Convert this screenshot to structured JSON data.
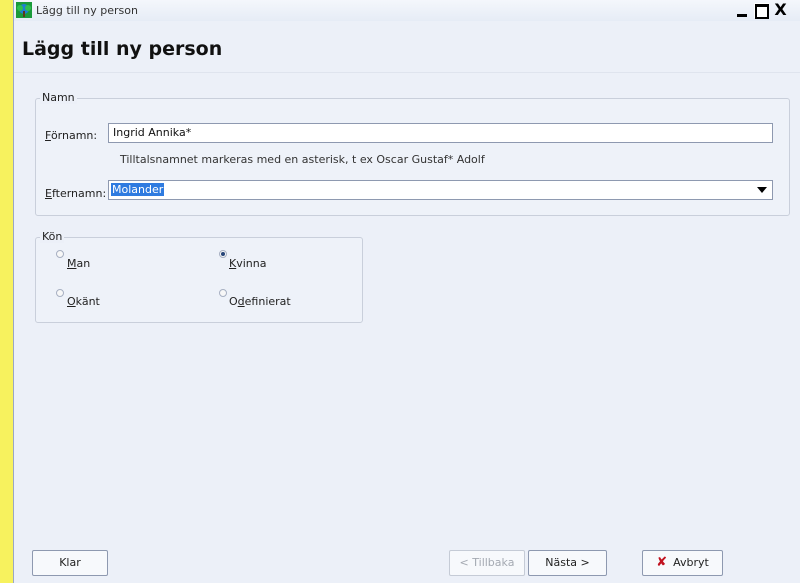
{
  "window": {
    "title": "Lägg till ny person",
    "close_symbol": "X"
  },
  "heading": "Lägg till ny person",
  "namn_group": {
    "label": "Namn",
    "fornamn_label_prefix": "F",
    "fornamn_label_rest": "örnamn:",
    "fornamn_value": "Ingrid Annika*",
    "hint": "Tilltalsnamnet markeras med en asterisk, t ex  Oscar Gustaf* Adolf",
    "efternamn_label_prefix": "E",
    "efternamn_label_rest": "fternamn:",
    "efternamn_value": "Molander"
  },
  "kon_group": {
    "label": "Kön",
    "options": [
      {
        "prefix": "",
        "mnemonic": "M",
        "rest": "an",
        "selected": false
      },
      {
        "prefix": "",
        "mnemonic": "K",
        "rest": "vinna",
        "selected": true
      },
      {
        "prefix": "",
        "mnemonic": "O",
        "rest": "känt",
        "selected": false
      },
      {
        "prefix": "O",
        "mnemonic": "d",
        "rest": "efinierat",
        "selected": false
      }
    ]
  },
  "buttons": {
    "klar": "Klar",
    "tillbaka": "< Tillbaka",
    "nasta": "Nästa >",
    "avbryt": "Avbryt"
  }
}
